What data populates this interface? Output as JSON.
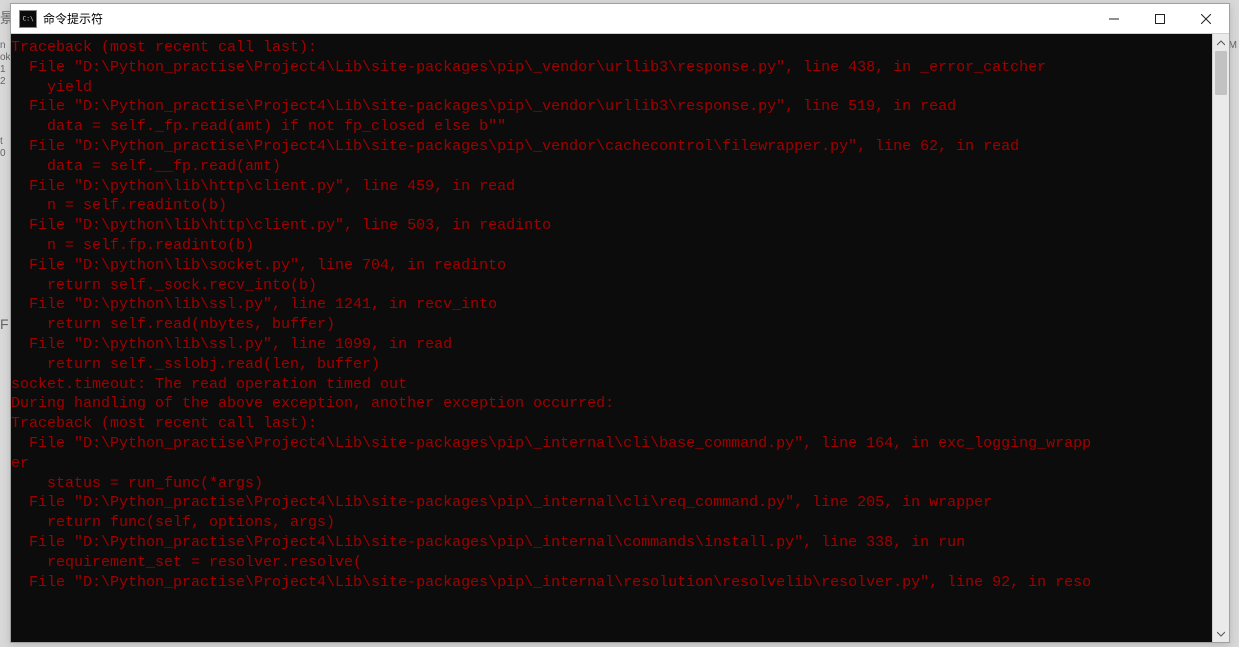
{
  "window": {
    "title": "命令提示符",
    "icon_label": "C:\\"
  },
  "bg": {
    "frag1": "景",
    "frag2": "n",
    "frag3": "ok",
    "frag4": "1",
    "frag5": "2",
    "frag6": "t",
    "frag7": "0",
    "frag8": "F",
    "frag9": "M"
  },
  "terminal": {
    "lines": [
      "Traceback (most recent call last):",
      "  File \"D:\\Python_practise\\Project4\\Lib\\site-packages\\pip\\_vendor\\urllib3\\response.py\", line 438, in _error_catcher",
      "    yield",
      "  File \"D:\\Python_practise\\Project4\\Lib\\site-packages\\pip\\_vendor\\urllib3\\response.py\", line 519, in read",
      "    data = self._fp.read(amt) if not fp_closed else b\"\"",
      "  File \"D:\\Python_practise\\Project4\\Lib\\site-packages\\pip\\_vendor\\cachecontrol\\filewrapper.py\", line 62, in read",
      "    data = self.__fp.read(amt)",
      "  File \"D:\\python\\lib\\http\\client.py\", line 459, in read",
      "    n = self.readinto(b)",
      "  File \"D:\\python\\lib\\http\\client.py\", line 503, in readinto",
      "    n = self.fp.readinto(b)",
      "  File \"D:\\python\\lib\\socket.py\", line 704, in readinto",
      "    return self._sock.recv_into(b)",
      "  File \"D:\\python\\lib\\ssl.py\", line 1241, in recv_into",
      "    return self.read(nbytes, buffer)",
      "  File \"D:\\python\\lib\\ssl.py\", line 1099, in read",
      "    return self._sslobj.read(len, buffer)",
      "socket.timeout: The read operation timed out",
      "",
      "During handling of the above exception, another exception occurred:",
      "",
      "Traceback (most recent call last):",
      "  File \"D:\\Python_practise\\Project4\\Lib\\site-packages\\pip\\_internal\\cli\\base_command.py\", line 164, in exc_logging_wrapp",
      "er",
      "    status = run_func(*args)",
      "  File \"D:\\Python_practise\\Project4\\Lib\\site-packages\\pip\\_internal\\cli\\req_command.py\", line 205, in wrapper",
      "    return func(self, options, args)",
      "  File \"D:\\Python_practise\\Project4\\Lib\\site-packages\\pip\\_internal\\commands\\install.py\", line 338, in run",
      "    requirement_set = resolver.resolve(",
      "  File \"D:\\Python_practise\\Project4\\Lib\\site-packages\\pip\\_internal\\resolution\\resolvelib\\resolver.py\", line 92, in reso"
    ]
  }
}
